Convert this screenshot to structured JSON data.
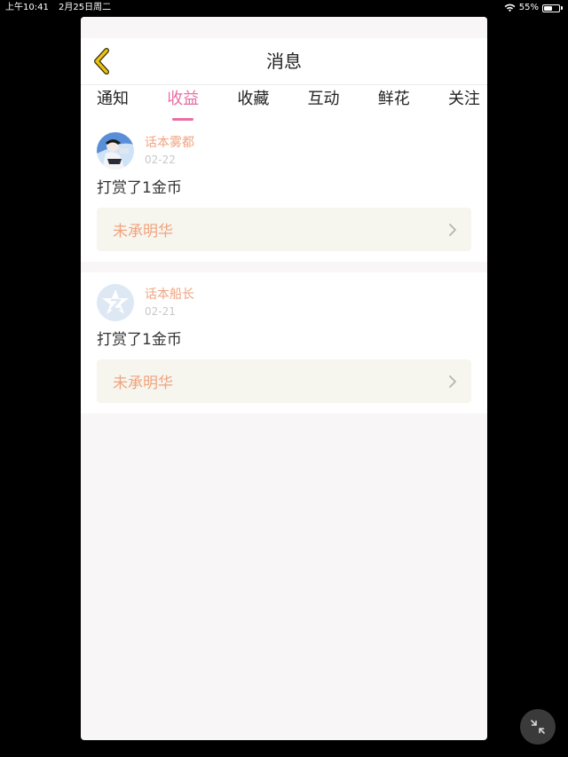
{
  "status_bar": {
    "time": "上午10:41",
    "date": "2月25日周二",
    "battery": "55%",
    "battery_level": 0.55,
    "icons": [
      "wifi-icon",
      "battery-icon"
    ]
  },
  "header": {
    "title": "消息",
    "back_icon": "chevron-left-icon",
    "back_color": "#d9b100"
  },
  "tabs": [
    {
      "label": "通知",
      "active": false
    },
    {
      "label": "收益",
      "active": true
    },
    {
      "label": "收藏",
      "active": false
    },
    {
      "label": "互动",
      "active": false
    },
    {
      "label": "鲜花",
      "active": false
    },
    {
      "label": "关注",
      "active": false
    }
  ],
  "messages": [
    {
      "user": "话本雾都",
      "date": "02-22",
      "text": "打赏了1金币",
      "link": "未承明华",
      "avatar": "user-photo-avatar"
    },
    {
      "user": "话本船长",
      "date": "02-21",
      "text": "打赏了1金币",
      "link": "未承明华",
      "avatar": "default-star-avatar"
    }
  ],
  "colors": {
    "accent": "#e86ea6",
    "username": "#f0a47f",
    "link_bg": "#f6f5ee"
  }
}
